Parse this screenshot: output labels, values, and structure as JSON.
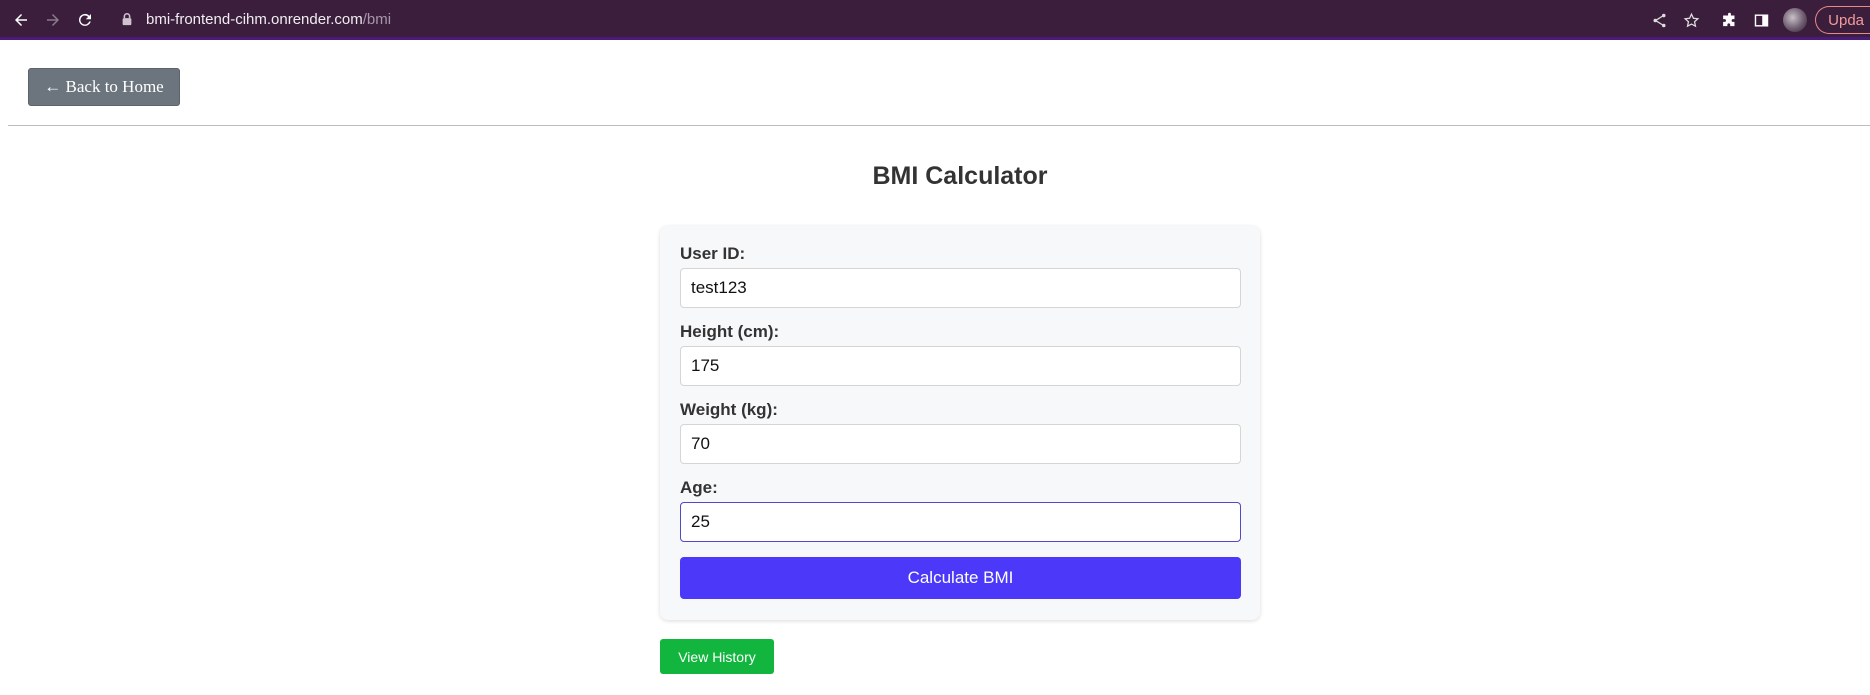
{
  "browser": {
    "url_host": "bmi-frontend-cihm.onrender.com",
    "url_path": "/bmi",
    "update_label": "Upda",
    "icons": [
      "back-arrow-icon",
      "forward-arrow-icon",
      "reload-icon",
      "lock-icon",
      "share-icon",
      "star-icon",
      "puzzle-icon",
      "sidebar-icon",
      "profile-avatar"
    ],
    "colors": {
      "chrome_bg": "#3a1e3c",
      "accent_bar": "#4a1a78",
      "update_pill": "#f29b9b"
    }
  },
  "nav": {
    "back_label": "← Back to Home"
  },
  "page": {
    "title": "BMI Calculator"
  },
  "form": {
    "user_id": {
      "label": "User ID:",
      "value": "test123"
    },
    "height": {
      "label": "Height (cm):",
      "value": "175"
    },
    "weight": {
      "label": "Weight (kg):",
      "value": "70"
    },
    "age": {
      "label": "Age:",
      "value": "25"
    },
    "submit_label": "Calculate BMI"
  },
  "history": {
    "label": "View History"
  },
  "colors": {
    "back_button": "#6c757d",
    "calc_button": "#4b38f8",
    "history_button": "#12b63e",
    "focus_border": "#5348c7"
  }
}
